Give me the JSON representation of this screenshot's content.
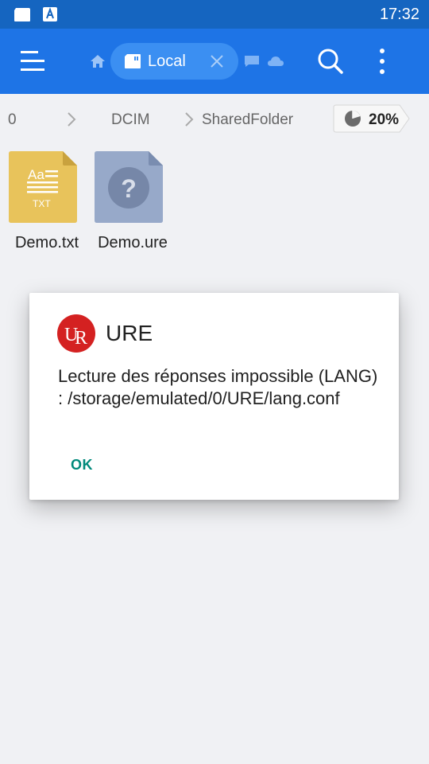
{
  "status_bar": {
    "time": "17:32"
  },
  "tabs": {
    "active_label": "Local"
  },
  "breadcrumb": {
    "items": [
      "0",
      "DCIM",
      "SharedFolder"
    ]
  },
  "storage": {
    "usage": "20%"
  },
  "files": [
    {
      "name": "Demo.txt",
      "type_label": "TXT",
      "icon_text": "Aa"
    },
    {
      "name": "Demo.ure",
      "icon_text": "?"
    }
  ],
  "dialog": {
    "title": "URE",
    "message": "Lecture des réponses impossible (LANG) : /storage/emulated/0/URE/lang.conf",
    "ok_label": "OK"
  },
  "colors": {
    "status_bar": "#1565c0",
    "app_bar": "#1e74e6",
    "accent": "#00897b",
    "logo_red": "#d42121"
  }
}
